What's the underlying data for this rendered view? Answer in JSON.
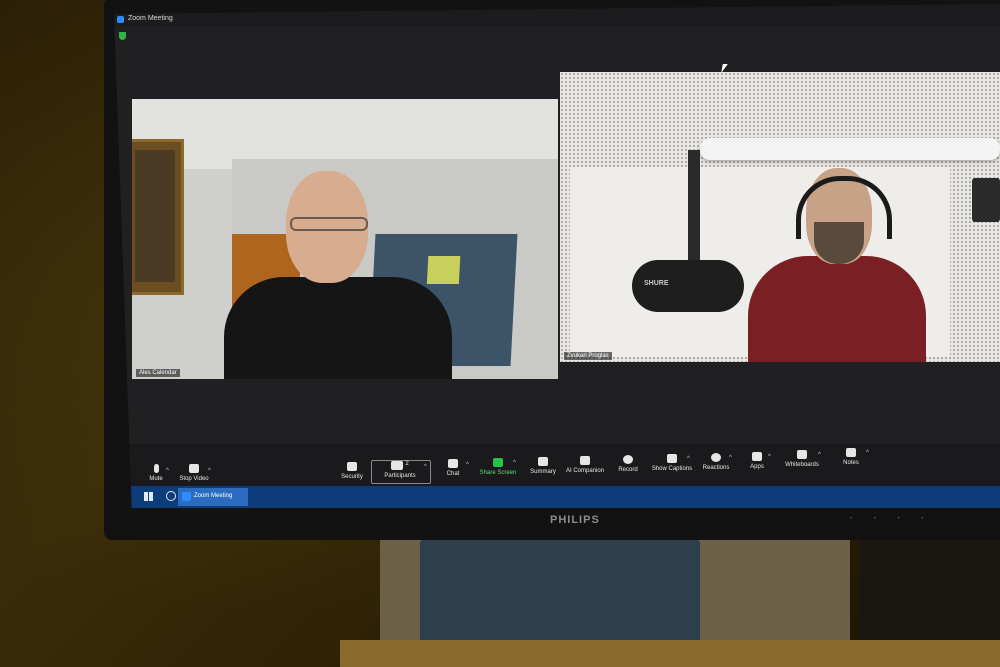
{
  "window": {
    "title": "Zoom Meeting"
  },
  "participants": {
    "left_name": "Ales Calendar",
    "right_name": "Zvukari Proglas"
  },
  "toolbar": {
    "mute": "Mute",
    "stop_video": "Stop Video",
    "security": "Security",
    "participants": "Participants",
    "participants_count": "2",
    "chat": "Chat",
    "share_screen": "Share Screen",
    "summary": "Summary",
    "ai_companion": "AI Companion",
    "record": "Record",
    "show_captions": "Show Captions",
    "reactions": "Reactions",
    "apps": "Apps",
    "whiteboards": "Whiteboards",
    "notes": "Notes"
  },
  "taskbar": {
    "app_label": "Zoom Meeting"
  },
  "monitor": {
    "brand": "PHILIPS"
  },
  "mic": {
    "brand": "SHURE"
  },
  "colors": {
    "share_green": "#27c24c",
    "taskbar_blue": "#0d3c7a",
    "zoom_blue": "#2d8cff"
  }
}
